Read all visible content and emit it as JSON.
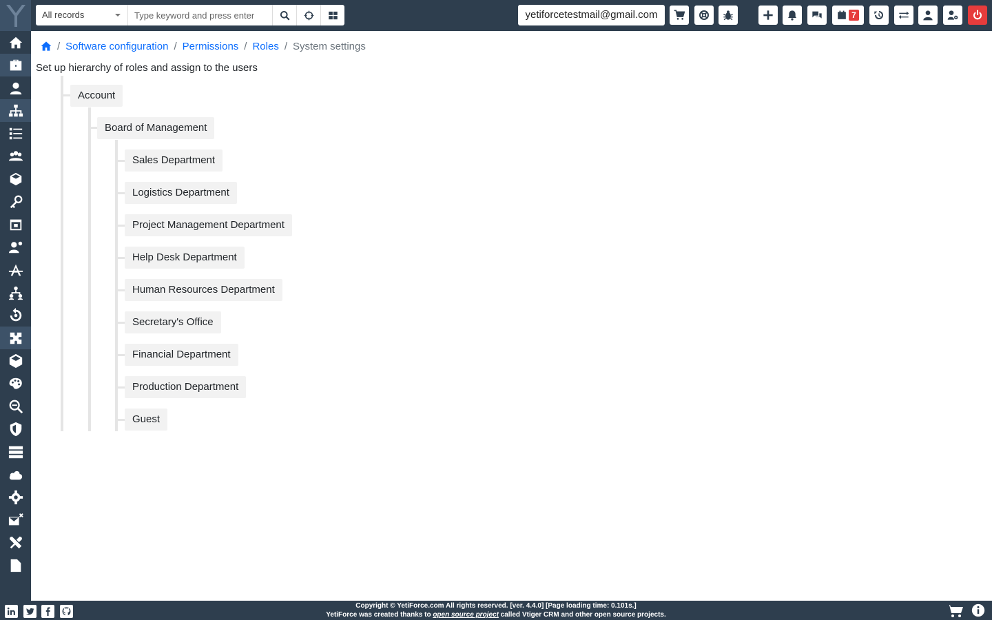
{
  "topbar": {
    "select_value": "All records",
    "search_placeholder": "Type keyword and press enter",
    "user_email": "yetiforcetestmail@gmail.com",
    "calendar_badge": "7"
  },
  "breadcrumb": {
    "items": [
      "Software configuration",
      "Permissions",
      "Roles"
    ],
    "current": "System settings"
  },
  "page": {
    "subtitle": "Set up hierarchy of roles and assign to the users"
  },
  "roles": {
    "root": "Account",
    "level1": "Board of Management",
    "level2": [
      "Sales Department",
      "Logistics Department",
      "Project Management Department",
      "Help Desk Department",
      "Human Resources Department",
      "Secretary's Office",
      "Financial Department",
      "Production Department",
      "Guest"
    ]
  },
  "footer": {
    "line1": "Copyright © YetiForce.com All rights reserved. [ver. 4.4.0] [Page loading time: 0.101s.]",
    "line2_before": "YetiForce was created thanks to ",
    "line2_link": "open source project",
    "line2_after": " called Vtiger CRM and other open source projects."
  },
  "icons": {
    "sidebar": [
      "home-icon",
      "toolbox-icon",
      "user-icon",
      "sitemap-icon",
      "list-icon",
      "users-icon",
      "cubes-icon",
      "key-icon",
      "calendar-lock-icon",
      "user-cog-icon",
      "activity-icon",
      "user-tree-icon",
      "sync-icon",
      "puzzle-icon",
      "cube-icon",
      "palette-icon",
      "search-plus-icon",
      "shield-icon",
      "server-icon",
      "cloud-icon",
      "cogs-icon",
      "mail-x-icon",
      "tools-icon",
      "file-icon"
    ]
  },
  "colors": {
    "nav_bg": "#2e3e4e",
    "link": "#0d6efd",
    "danger": "#e63c3c",
    "node_bg": "#f2f2f2"
  }
}
